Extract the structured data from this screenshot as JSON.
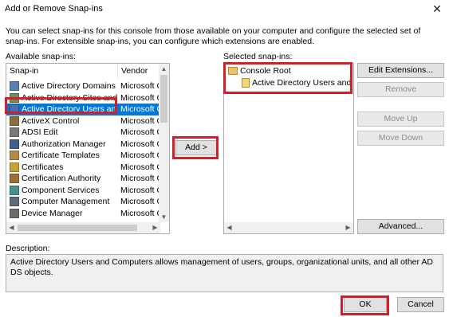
{
  "window": {
    "title": "Add or Remove Snap-ins",
    "close_glyph": "✕"
  },
  "intro_text": "You can select snap-ins for this console from those available on your computer and configure the selected set of snap-ins. For extensible snap-ins, you can configure which extensions are enabled.",
  "available": {
    "label": "Available snap-ins:",
    "columns": {
      "snapin": "Snap-in",
      "vendor": "Vendor"
    },
    "rows": [
      {
        "name": "Active Directory Domains ...",
        "vendor": "Microsoft Co",
        "icon": "ad-domains-icon"
      },
      {
        "name": "Active Directory Sites and...",
        "vendor": "Microsoft Co",
        "icon": "ad-sites-icon"
      },
      {
        "name": "Active Directory Users an...",
        "vendor": "Microsoft Co",
        "icon": "ad-users-icon",
        "selected": true
      },
      {
        "name": "ActiveX Control",
        "vendor": "Microsoft Co",
        "icon": "activex-icon"
      },
      {
        "name": "ADSI Edit",
        "vendor": "Microsoft Co",
        "icon": "adsi-edit-icon"
      },
      {
        "name": "Authorization Manager",
        "vendor": "Microsoft Co",
        "icon": "authorization-icon"
      },
      {
        "name": "Certificate Templates",
        "vendor": "Microsoft Co",
        "icon": "certificate-templates-icon"
      },
      {
        "name": "Certificates",
        "vendor": "Microsoft Co",
        "icon": "certificates-icon"
      },
      {
        "name": "Certification Authority",
        "vendor": "Microsoft Co",
        "icon": "certification-authority-icon"
      },
      {
        "name": "Component Services",
        "vendor": "Microsoft Co",
        "icon": "component-services-icon"
      },
      {
        "name": "Computer Management",
        "vendor": "Microsoft Co",
        "icon": "computer-management-icon"
      },
      {
        "name": "Device Manager",
        "vendor": "Microsoft Co",
        "icon": "device-manager-icon"
      }
    ]
  },
  "add_button": "Add >",
  "selected": {
    "label": "Selected snap-ins:",
    "root": "Console Root",
    "child": "Active Directory Users and Com"
  },
  "side_buttons": {
    "edit_extensions": "Edit Extensions...",
    "remove": "Remove",
    "move_up": "Move Up",
    "move_down": "Move Down",
    "advanced": "Advanced..."
  },
  "description": {
    "label": "Description:",
    "text": "Active Directory Users and Computers allows management of users, groups, organizational units, and all other AD DS objects."
  },
  "footer": {
    "ok": "OK",
    "cancel": "Cancel"
  },
  "colors": {
    "highlight": "#0078d7",
    "annotation_red": "#d21f2a"
  }
}
